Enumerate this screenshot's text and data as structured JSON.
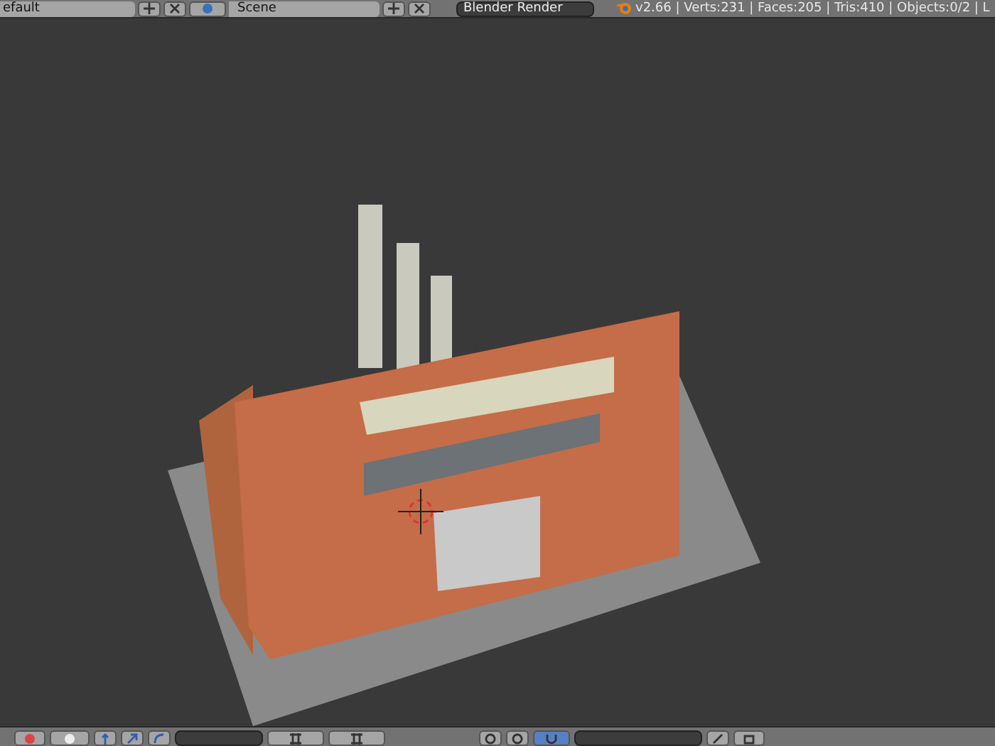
{
  "top_bar": {
    "screen_field": "efault",
    "scene_field": "Scene",
    "render_engine": "Blender Render",
    "stats": "v2.66 | Verts:231 | Faces:205 | Tris:410 | Objects:0/2 | L"
  },
  "bottom_bar": {
    "snap_on": true
  }
}
